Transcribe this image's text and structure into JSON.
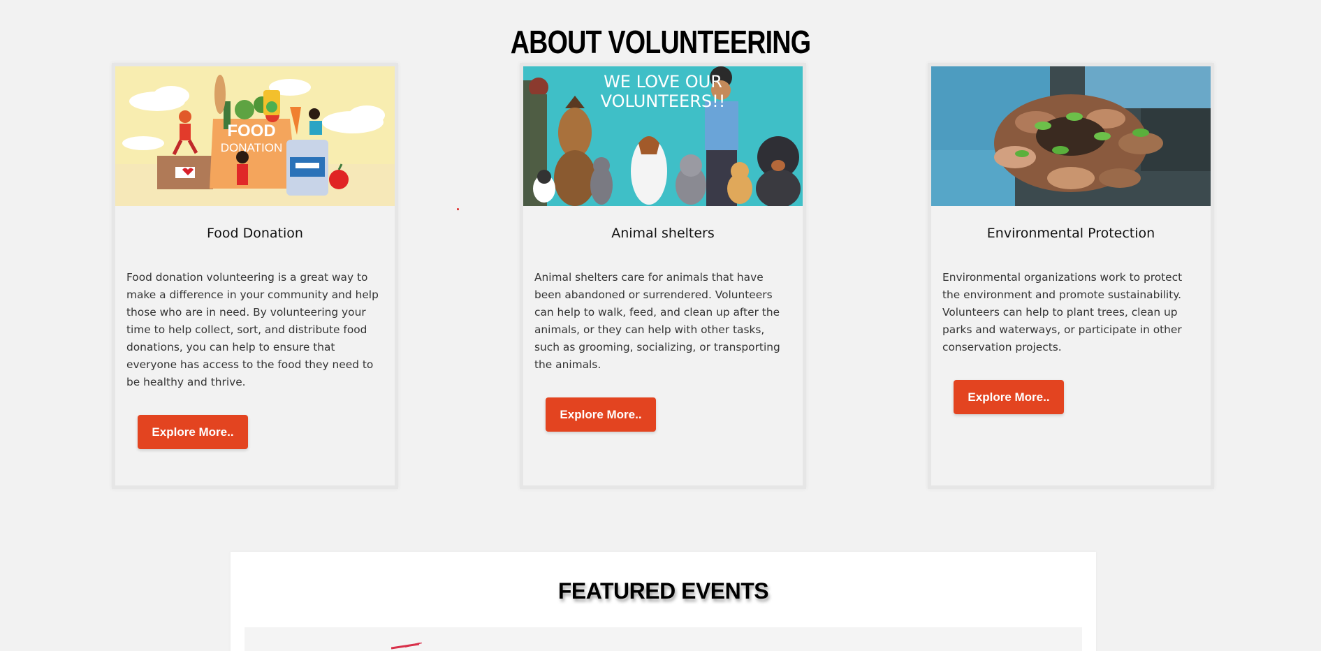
{
  "about": {
    "title": "ABOUT VOLUNTEERING"
  },
  "cards": [
    {
      "image_label": "food-donation-illustration",
      "image_text_line1": "FOOD",
      "image_text_line2": "DONATION",
      "title": "Food Donation",
      "text": "Food donation volunteering is a great way to make a difference in your community and help those who are in need. By volunteering your time to help collect, sort, and distribute food donations, you can help to ensure that everyone has access to the food they need to be healthy and thrive.",
      "button": "Explore More.."
    },
    {
      "image_label": "animal-shelter-illustration",
      "image_text_line1": "WE LOVE OUR",
      "image_text_line2": "VOLUNTEERS!!",
      "title": "Animal shelters",
      "text": "Animal shelters care for animals that have been abandoned or surrendered. Volunteers can help to walk, feed, and clean up after the animals, or they can help with other tasks, such as grooming, socializing, or transporting the animals.",
      "button": "Explore More.."
    },
    {
      "image_label": "environment-hands-photo",
      "title": "Environmental Protection",
      "text": "Environmental organizations work to protect the environment and promote sustainability. Volunteers can help to plant trees, clean up parks and waterways, or participate in other conservation projects.",
      "button": "Explore More.."
    }
  ],
  "featured": {
    "title": "FEATURED EVENTS"
  },
  "colors": {
    "page_background": "#f2f2f2",
    "accent": "#e34420",
    "card_border": "#e6e6e6"
  }
}
